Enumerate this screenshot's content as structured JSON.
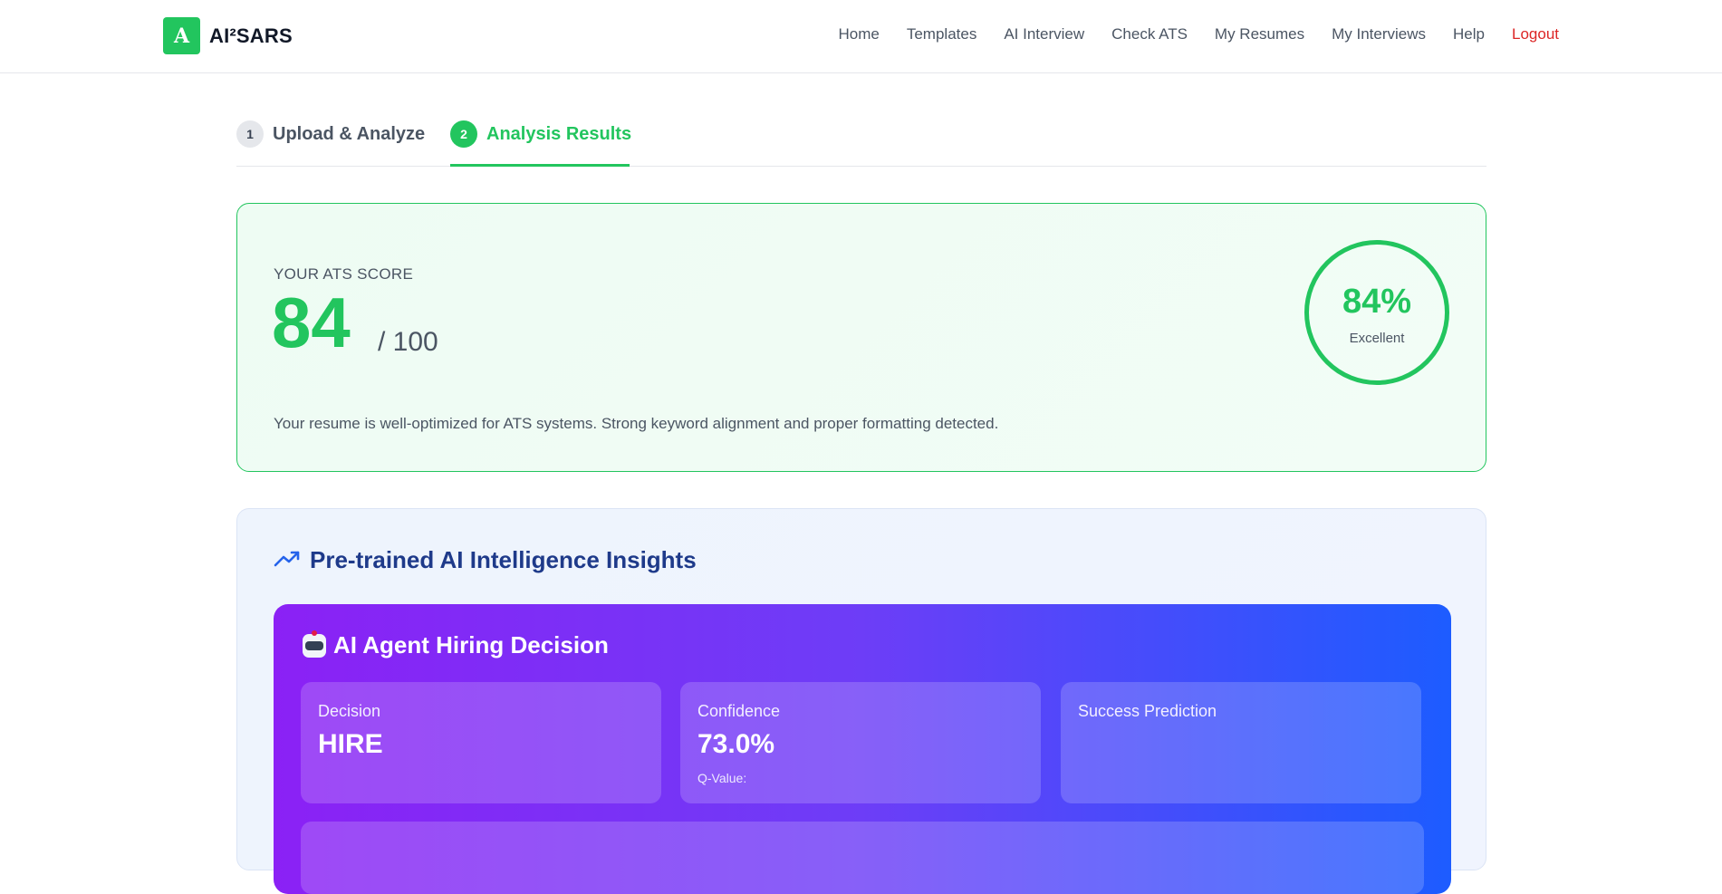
{
  "brand": {
    "mark": "A",
    "name": "AI²SARS"
  },
  "nav": {
    "items": [
      "Home",
      "Templates",
      "AI Interview",
      "Check ATS",
      "My Resumes",
      "My Interviews",
      "Help"
    ],
    "logout": "Logout"
  },
  "steps": [
    {
      "num": "1",
      "label": "Upload & Analyze"
    },
    {
      "num": "2",
      "label": "Analysis Results"
    }
  ],
  "score": {
    "label": "YOUR ATS SCORE",
    "value": "84",
    "max": "/ 100",
    "description": "Your resume is well-optimized for ATS systems. Strong keyword alignment and proper formatting detected.",
    "ring_percent": "84%",
    "ring_rating": "Excellent"
  },
  "insights": {
    "title": "Pre-trained AI Intelligence Insights",
    "icon": "trending-up-icon",
    "agent": {
      "title": "AI Agent Hiring Decision",
      "icon": "robot-icon",
      "metrics": [
        {
          "label": "Decision",
          "value": "HIRE",
          "sub": ""
        },
        {
          "label": "Confidence",
          "value": "73.0%",
          "sub": "Q-Value:"
        },
        {
          "label": "Success Prediction",
          "value": "",
          "sub": ""
        }
      ]
    }
  },
  "colors": {
    "accent": "#22c55e",
    "logout": "#dc2626",
    "insight_title": "#1e3a8a",
    "agent_start": "#8b21f5",
    "agent_end": "#1d5cff"
  }
}
